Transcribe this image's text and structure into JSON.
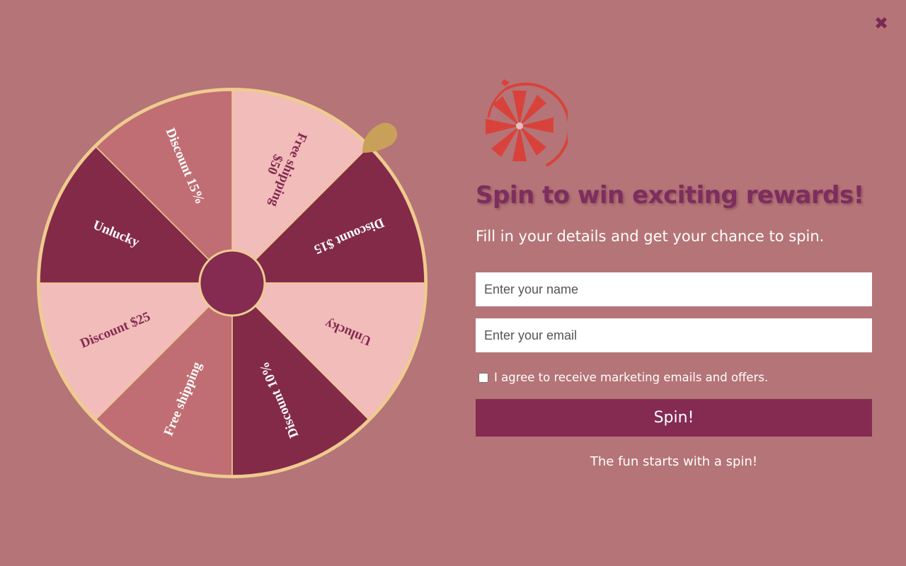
{
  "close": {
    "icon": "close-icon",
    "glyph": "✖"
  },
  "wheel": {
    "segments": [
      {
        "label": "Free shipping $50",
        "lines": [
          "Free shipping",
          "$50"
        ],
        "color": "#f1bcb9",
        "text_color": "#842a52"
      },
      {
        "label": "Discount $15",
        "lines": [
          "Discount $15"
        ],
        "color": "#832a48",
        "text_color": "#ffffff"
      },
      {
        "label": "Unlucky",
        "lines": [
          "Unlucky"
        ],
        "color": "#f1bcb9",
        "text_color": "#842a52"
      },
      {
        "label": "Discount 10%",
        "lines": [
          "Discount 10%"
        ],
        "color": "#832a48",
        "text_color": "#ffffff"
      },
      {
        "label": "Free shipping",
        "lines": [
          "Free shipping"
        ],
        "color": "#c06e73",
        "text_color": "#ffffff"
      },
      {
        "label": "Discount $25",
        "lines": [
          "Discount $25"
        ],
        "color": "#f1bcb9",
        "text_color": "#842a52"
      },
      {
        "label": "Unlucky",
        "lines": [
          "Unlucky"
        ],
        "color": "#832a48",
        "text_color": "#ffffff"
      },
      {
        "label": "Discount 15%",
        "lines": [
          "Discount 15%"
        ],
        "color": "#c06e73",
        "text_color": "#ffffff"
      }
    ],
    "rim_color": "#eecb8f",
    "hub_color": "#852b52",
    "pointer_color": "#c9a05a",
    "pointer_icon": "pointer-icon"
  },
  "logo": {
    "icon": "spinning-wheel-logo-icon",
    "color": "#d9423a"
  },
  "form": {
    "title": "Spin to win exciting rewards!",
    "subtitle": "Fill in your details and get your chance to spin.",
    "name_placeholder": "Enter your name",
    "email_placeholder": "Enter your email",
    "consent_label": "I agree to receive marketing emails and offers.",
    "spin_label": "Spin!",
    "footer": "The fun starts with a spin!"
  },
  "colors": {
    "background": "#b57477",
    "accent": "#852b52",
    "title": "#7d2d5e"
  }
}
